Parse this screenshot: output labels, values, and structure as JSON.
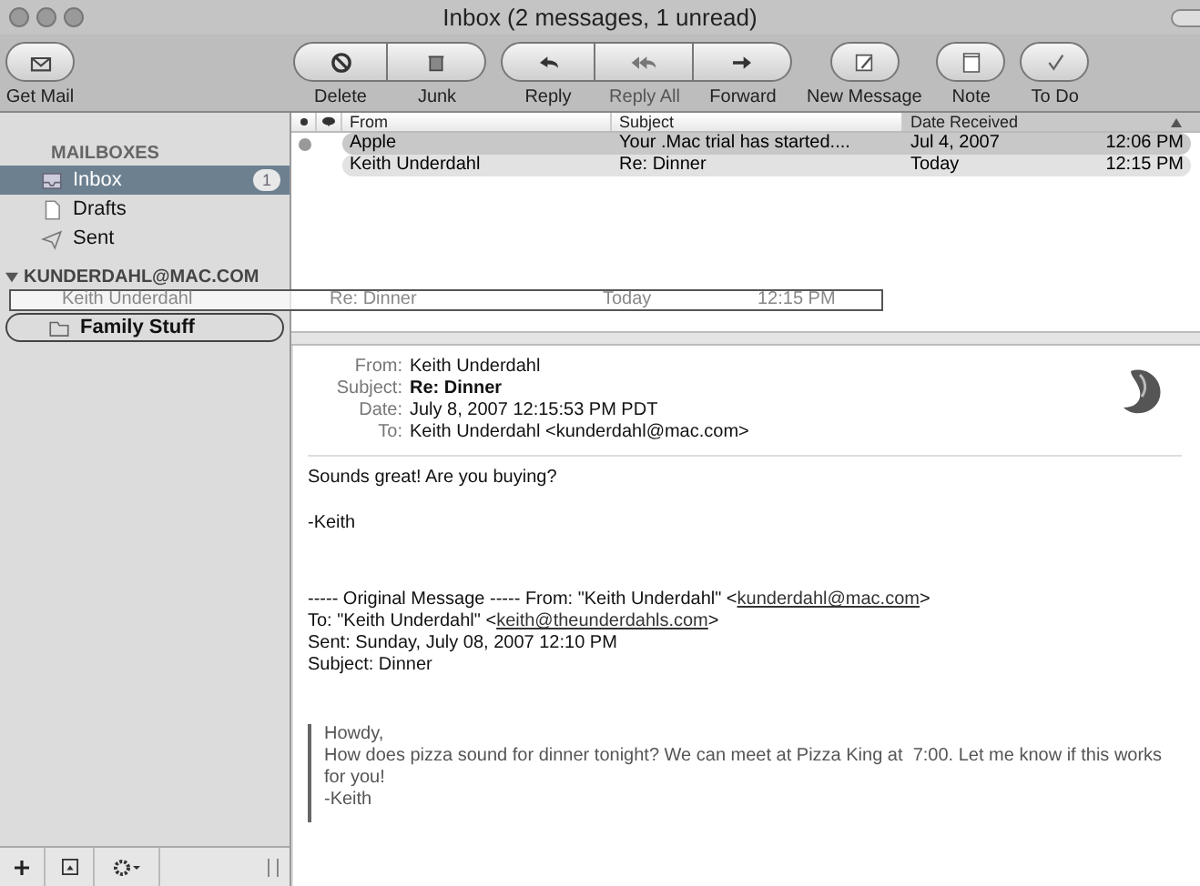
{
  "window": {
    "title": "Inbox (2 messages, 1 unread)"
  },
  "toolbar": [
    {
      "label": "Get Mail",
      "kind": "single"
    },
    {
      "label": "Delete",
      "kind": "left"
    },
    {
      "label": "Junk",
      "kind": "right"
    },
    {
      "label": "Reply",
      "kind": "left"
    },
    {
      "label": "Reply All",
      "kind": "middle"
    },
    {
      "label": "Forward",
      "kind": "right"
    },
    {
      "label": "New Message",
      "kind": "single"
    },
    {
      "label": "Note",
      "kind": "single"
    },
    {
      "label": "To Do",
      "kind": "single"
    }
  ],
  "sidebar": {
    "sections": [
      {
        "title": "MAILBOXES",
        "expandable": false,
        "items": [
          {
            "label": "Inbox",
            "selected": true,
            "badge": "1",
            "drop_target": false
          },
          {
            "label": "Drafts",
            "selected": false,
            "drop_target": false
          },
          {
            "label": "Sent",
            "selected": false,
            "drop_target": false
          }
        ]
      },
      {
        "title": "KUNDERDAHL@MAC.COM",
        "expandable": true,
        "items": [
          {
            "label": "Family Stuff",
            "selected": false,
            "drop_target": true
          }
        ]
      }
    ]
  },
  "message_list": {
    "columns": [
      "From",
      "Subject",
      "Date Received"
    ],
    "rows": [
      {
        "unread": true,
        "from": "Apple",
        "subject": "Your .Mac trial has started....",
        "date": "Jul 4, 2007",
        "time": "12:06 PM",
        "selected": true
      },
      {
        "unread": false,
        "from": "Keith Underdahl",
        "subject": "Re: Dinner",
        "date": "Today",
        "time": "12:15 PM",
        "selected": false
      }
    ]
  },
  "drag_ghost": {
    "from": "Keith Underdahl",
    "subject": "Re: Dinner",
    "date": "Today",
    "time": "12:15 PM"
  },
  "message": {
    "headers": [
      {
        "label": "From:",
        "value": "Keith Underdahl",
        "bold": false
      },
      {
        "label": "Subject:",
        "value": "Re: Dinner",
        "bold": true
      },
      {
        "label": "Date:",
        "value": "July 8, 2007 12:15:53 PM PDT",
        "bold": false
      },
      {
        "label": "To:",
        "value": "Keith Underdahl <kunderdahl@mac.com>",
        "bold": false
      }
    ],
    "body": [
      "Sounds great! Are you buying?",
      "-Keith"
    ],
    "original_intro": "----- Original Message ----- From: \"Keith Underdahl\" <",
    "original_from_link": "kunderdahl@mac.com",
    "original_from_suffix": ">",
    "original_to_prefix": "To: \"Keith Underdahl\" <",
    "original_to_link": "keith@theunderdahls.com",
    "original_to_suffix": ">",
    "original_lines": [
      "Sent: Sunday, July 08, 2007 12:10 PM",
      "Subject: Dinner"
    ],
    "quote": [
      "Howdy,",
      "How does pizza sound for dinner tonight? We can meet at Pizza King at  7:00. Let me know if this works for you!",
      "-Keith"
    ]
  }
}
